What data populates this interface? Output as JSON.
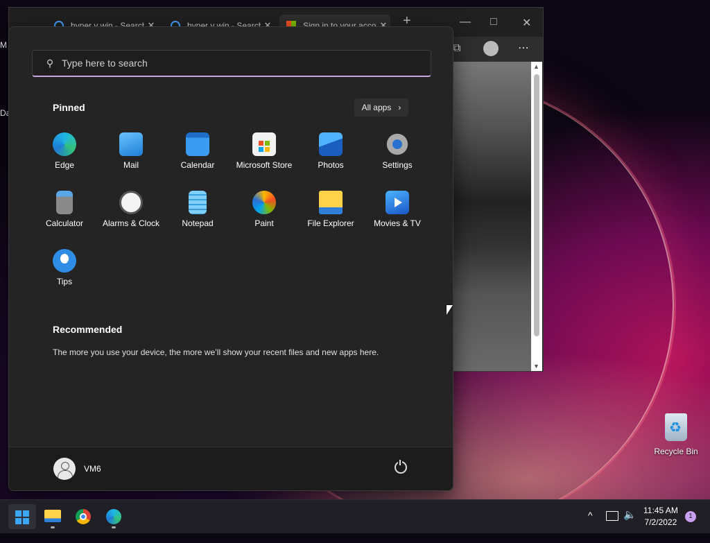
{
  "desktop": {
    "edge_text_1": "M",
    "edge_text_2": "Da",
    "recycle_bin_label": "Recycle Bin"
  },
  "browser": {
    "tabs": [
      {
        "title": "hyper v win - Search",
        "icon": "search-icon"
      },
      {
        "title": "hyper v win - Search",
        "icon": "search-icon"
      },
      {
        "title": "Sign in to your account",
        "icon": "microsoft-logo-icon"
      }
    ],
    "new_tab_label": "+",
    "close_tab_glyph": "✕"
  },
  "start_menu": {
    "search_placeholder": "Type here to search",
    "pinned_title": "Pinned",
    "all_apps_label": "All apps",
    "pinned_apps": [
      {
        "label": "Edge",
        "icon": "edge-icon"
      },
      {
        "label": "Mail",
        "icon": "mail-icon"
      },
      {
        "label": "Calendar",
        "icon": "calendar-icon"
      },
      {
        "label": "Microsoft Store",
        "icon": "store-icon"
      },
      {
        "label": "Photos",
        "icon": "photos-icon"
      },
      {
        "label": "Settings",
        "icon": "settings-icon"
      },
      {
        "label": "Calculator",
        "icon": "calculator-icon"
      },
      {
        "label": "Alarms & Clock",
        "icon": "clock-icon"
      },
      {
        "label": "Notepad",
        "icon": "notepad-icon"
      },
      {
        "label": "Paint",
        "icon": "paint-icon"
      },
      {
        "label": "File Explorer",
        "icon": "folder-icon"
      },
      {
        "label": "Movies & TV",
        "icon": "movies-icon"
      },
      {
        "label": "Tips",
        "icon": "tips-icon"
      }
    ],
    "recommended_title": "Recommended",
    "recommended_text": "The more you use your device, the more we’ll show your recent files and new apps here.",
    "user_name": "VM6"
  },
  "taskbar": {
    "clock_time": "11:45 AM",
    "clock_date": "7/2/2022",
    "notification_count": "1",
    "tray_chevron": "^"
  }
}
